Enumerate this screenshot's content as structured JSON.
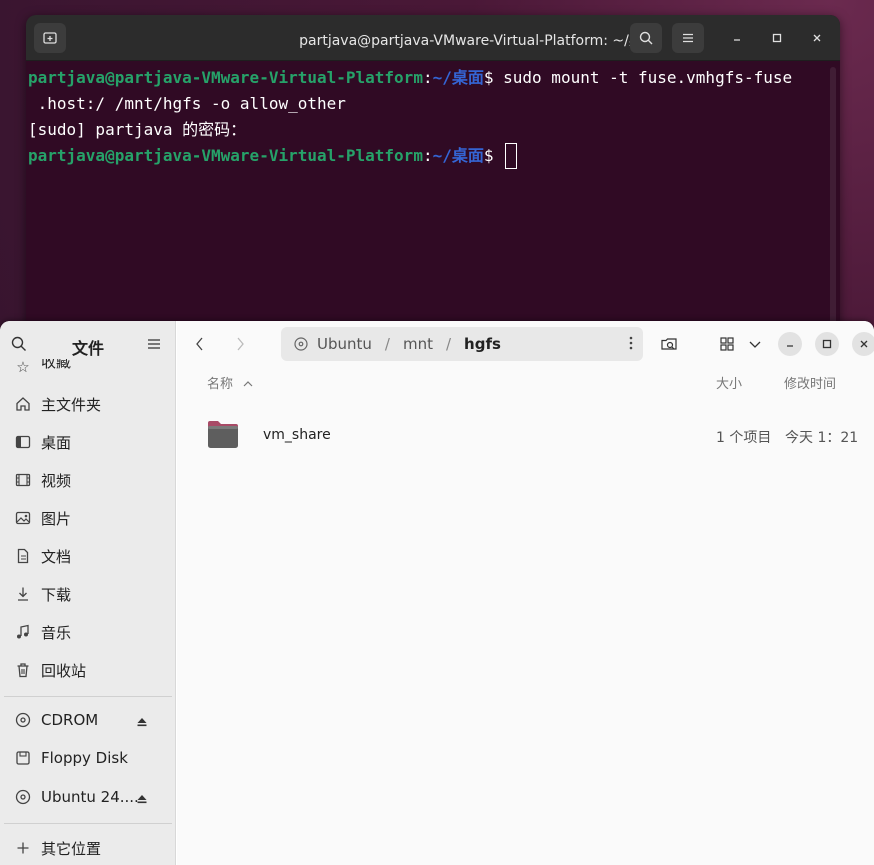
{
  "terminal": {
    "title": "partjava@partjava-VMware-Virtual-Platform: ~/桌面",
    "prompt_user": "partjava@partjava-VMware-Virtual-Platform",
    "prompt_colon": ":",
    "prompt_path": "~/桌面",
    "prompt_dollar": "$ ",
    "command_line1": "sudo mount -t fuse.vmhgfs-fuse",
    "command_line2": " .host:/ /mnt/hgfs -o allow_other",
    "sudo_prompt": "[sudo] partjava 的密码：",
    "colors": {
      "background": "#300a24",
      "user": "#26a269",
      "path": "#3465d4"
    }
  },
  "files": {
    "sidebar": {
      "title": "文件",
      "partial_item": "收藏",
      "items": [
        {
          "label": "主文件夹",
          "icon": "home-icon"
        },
        {
          "label": "桌面",
          "icon": "desktop-icon"
        },
        {
          "label": "视频",
          "icon": "video-icon"
        },
        {
          "label": "图片",
          "icon": "picture-icon"
        },
        {
          "label": "文档",
          "icon": "document-icon"
        },
        {
          "label": "下载",
          "icon": "download-icon"
        },
        {
          "label": "音乐",
          "icon": "music-icon"
        },
        {
          "label": "回收站",
          "icon": "trash-icon"
        }
      ],
      "devices": [
        {
          "label": "CDROM",
          "icon": "disc-icon"
        },
        {
          "label": "Floppy Disk",
          "icon": "drive-icon"
        },
        {
          "label": "Ubuntu 24....",
          "icon": "disc-icon"
        }
      ],
      "other_locations": "其它位置"
    },
    "path": {
      "crumbs": [
        "Ubuntu",
        "mnt",
        "hgfs"
      ],
      "separator": "/"
    },
    "columns": {
      "name": "名称",
      "size": "大小",
      "modified": "修改时间"
    },
    "rows": [
      {
        "name": "vm_share",
        "size": "1 个项目",
        "modified": "今天 1：21"
      }
    ]
  }
}
